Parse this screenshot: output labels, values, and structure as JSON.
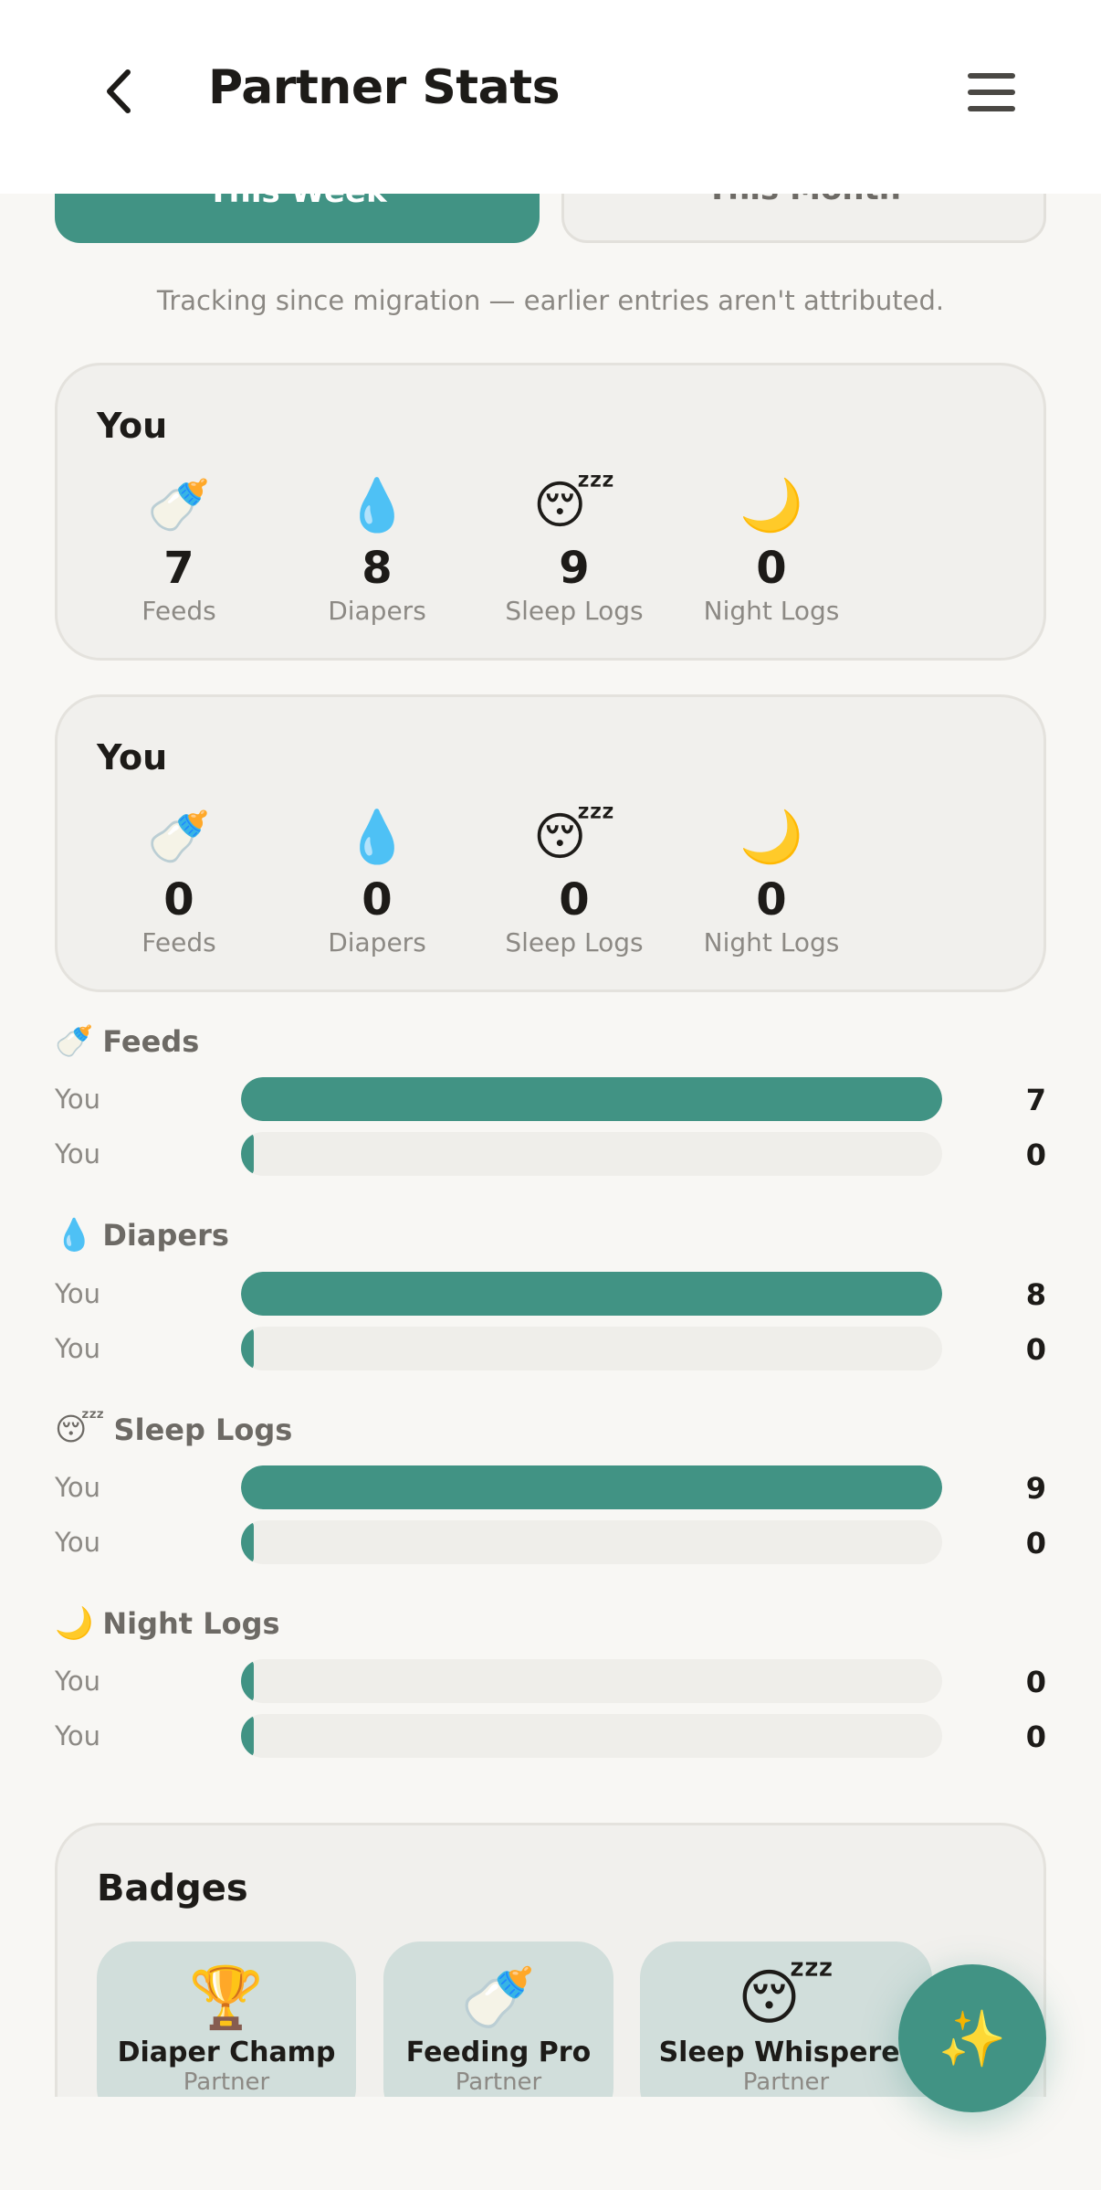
{
  "header": {
    "title": "Partner Stats",
    "back_icon": "chevron-left-icon",
    "menu_icon": "hamburger-menu-icon"
  },
  "period_tabs": [
    {
      "label": "This Week",
      "selected": true
    },
    {
      "label": "This Month",
      "selected": false
    }
  ],
  "notice": "Tracking since migration — earlier entries aren't attributed.",
  "stat_cards": [
    {
      "title": "You",
      "stats": [
        {
          "icon": "🍼",
          "value": "7",
          "label": "Feeds"
        },
        {
          "icon": "💧",
          "value": "8",
          "label": "Diapers"
        },
        {
          "icon": "😴",
          "value": "9",
          "label": "Sleep Logs"
        },
        {
          "icon": "🌙",
          "value": "0",
          "label": "Night Logs"
        }
      ]
    },
    {
      "title": "You",
      "stats": [
        {
          "icon": "🍼",
          "value": "0",
          "label": "Feeds"
        },
        {
          "icon": "💧",
          "value": "0",
          "label": "Diapers"
        },
        {
          "icon": "😴",
          "value": "0",
          "label": "Sleep Logs"
        },
        {
          "icon": "🌙",
          "value": "0",
          "label": "Night Logs"
        }
      ]
    }
  ],
  "comparisons": [
    {
      "icon": "🍼",
      "title": "Feeds",
      "rows": [
        {
          "label": "You",
          "value": "7",
          "fraction": 1.0
        },
        {
          "label": "You",
          "value": "0",
          "fraction": 0
        }
      ]
    },
    {
      "icon": "💧",
      "title": "Diapers",
      "rows": [
        {
          "label": "You",
          "value": "8",
          "fraction": 1.0
        },
        {
          "label": "You",
          "value": "0",
          "fraction": 0
        }
      ]
    },
    {
      "icon": "😴",
      "title": "Sleep Logs",
      "rows": [
        {
          "label": "You",
          "value": "9",
          "fraction": 1.0
        },
        {
          "label": "You",
          "value": "0",
          "fraction": 0
        }
      ]
    },
    {
      "icon": "🌙",
      "title": "Night Logs",
      "rows": [
        {
          "label": "You",
          "value": "0",
          "fraction": 0
        },
        {
          "label": "You",
          "value": "0",
          "fraction": 0
        }
      ]
    }
  ],
  "badges": {
    "title": "Badges",
    "items": [
      {
        "icon": "🏆",
        "name": "Diaper Champ",
        "sub": "Partner"
      },
      {
        "icon": "🍼",
        "name": "Feeding Pro",
        "sub": "Partner"
      },
      {
        "icon": "😴",
        "name": "Sleep Whisperer",
        "sub": "Partner"
      }
    ]
  },
  "fab": {
    "icon": "✨"
  },
  "colors": {
    "accent": "#419384",
    "background": "#f8f7f4",
    "card": "#f1f0ed",
    "badge_bg": "#d1dedb"
  }
}
